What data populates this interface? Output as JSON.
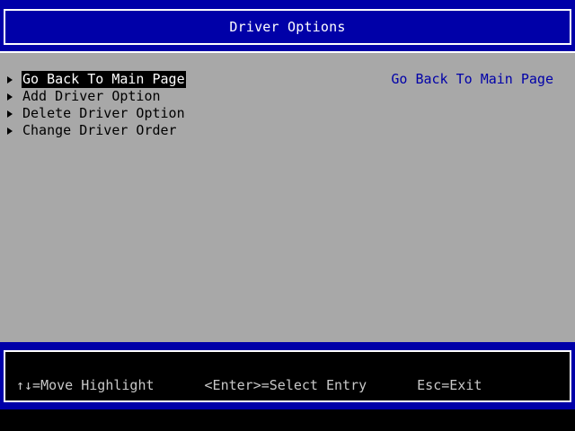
{
  "header": {
    "title": "Driver Options"
  },
  "menu": {
    "items": [
      {
        "label": "Go Back To Main Page",
        "selected": true
      },
      {
        "label": "Add Driver Option",
        "selected": false
      },
      {
        "label": "Delete Driver Option",
        "selected": false
      },
      {
        "label": "Change Driver Order",
        "selected": false
      }
    ]
  },
  "help": {
    "text": "Go Back To Main Page"
  },
  "footer": {
    "move": "↑↓=Move Highlight",
    "select": "<Enter>=Select Entry",
    "exit": "Esc=Exit"
  },
  "colors": {
    "band_blue": "#0000A8",
    "content_gray": "#A8A8A8",
    "help_blue": "#0000A8",
    "highlight_bg": "#000000"
  },
  "icons": {
    "menu_marker": "triangle-right-icon"
  }
}
